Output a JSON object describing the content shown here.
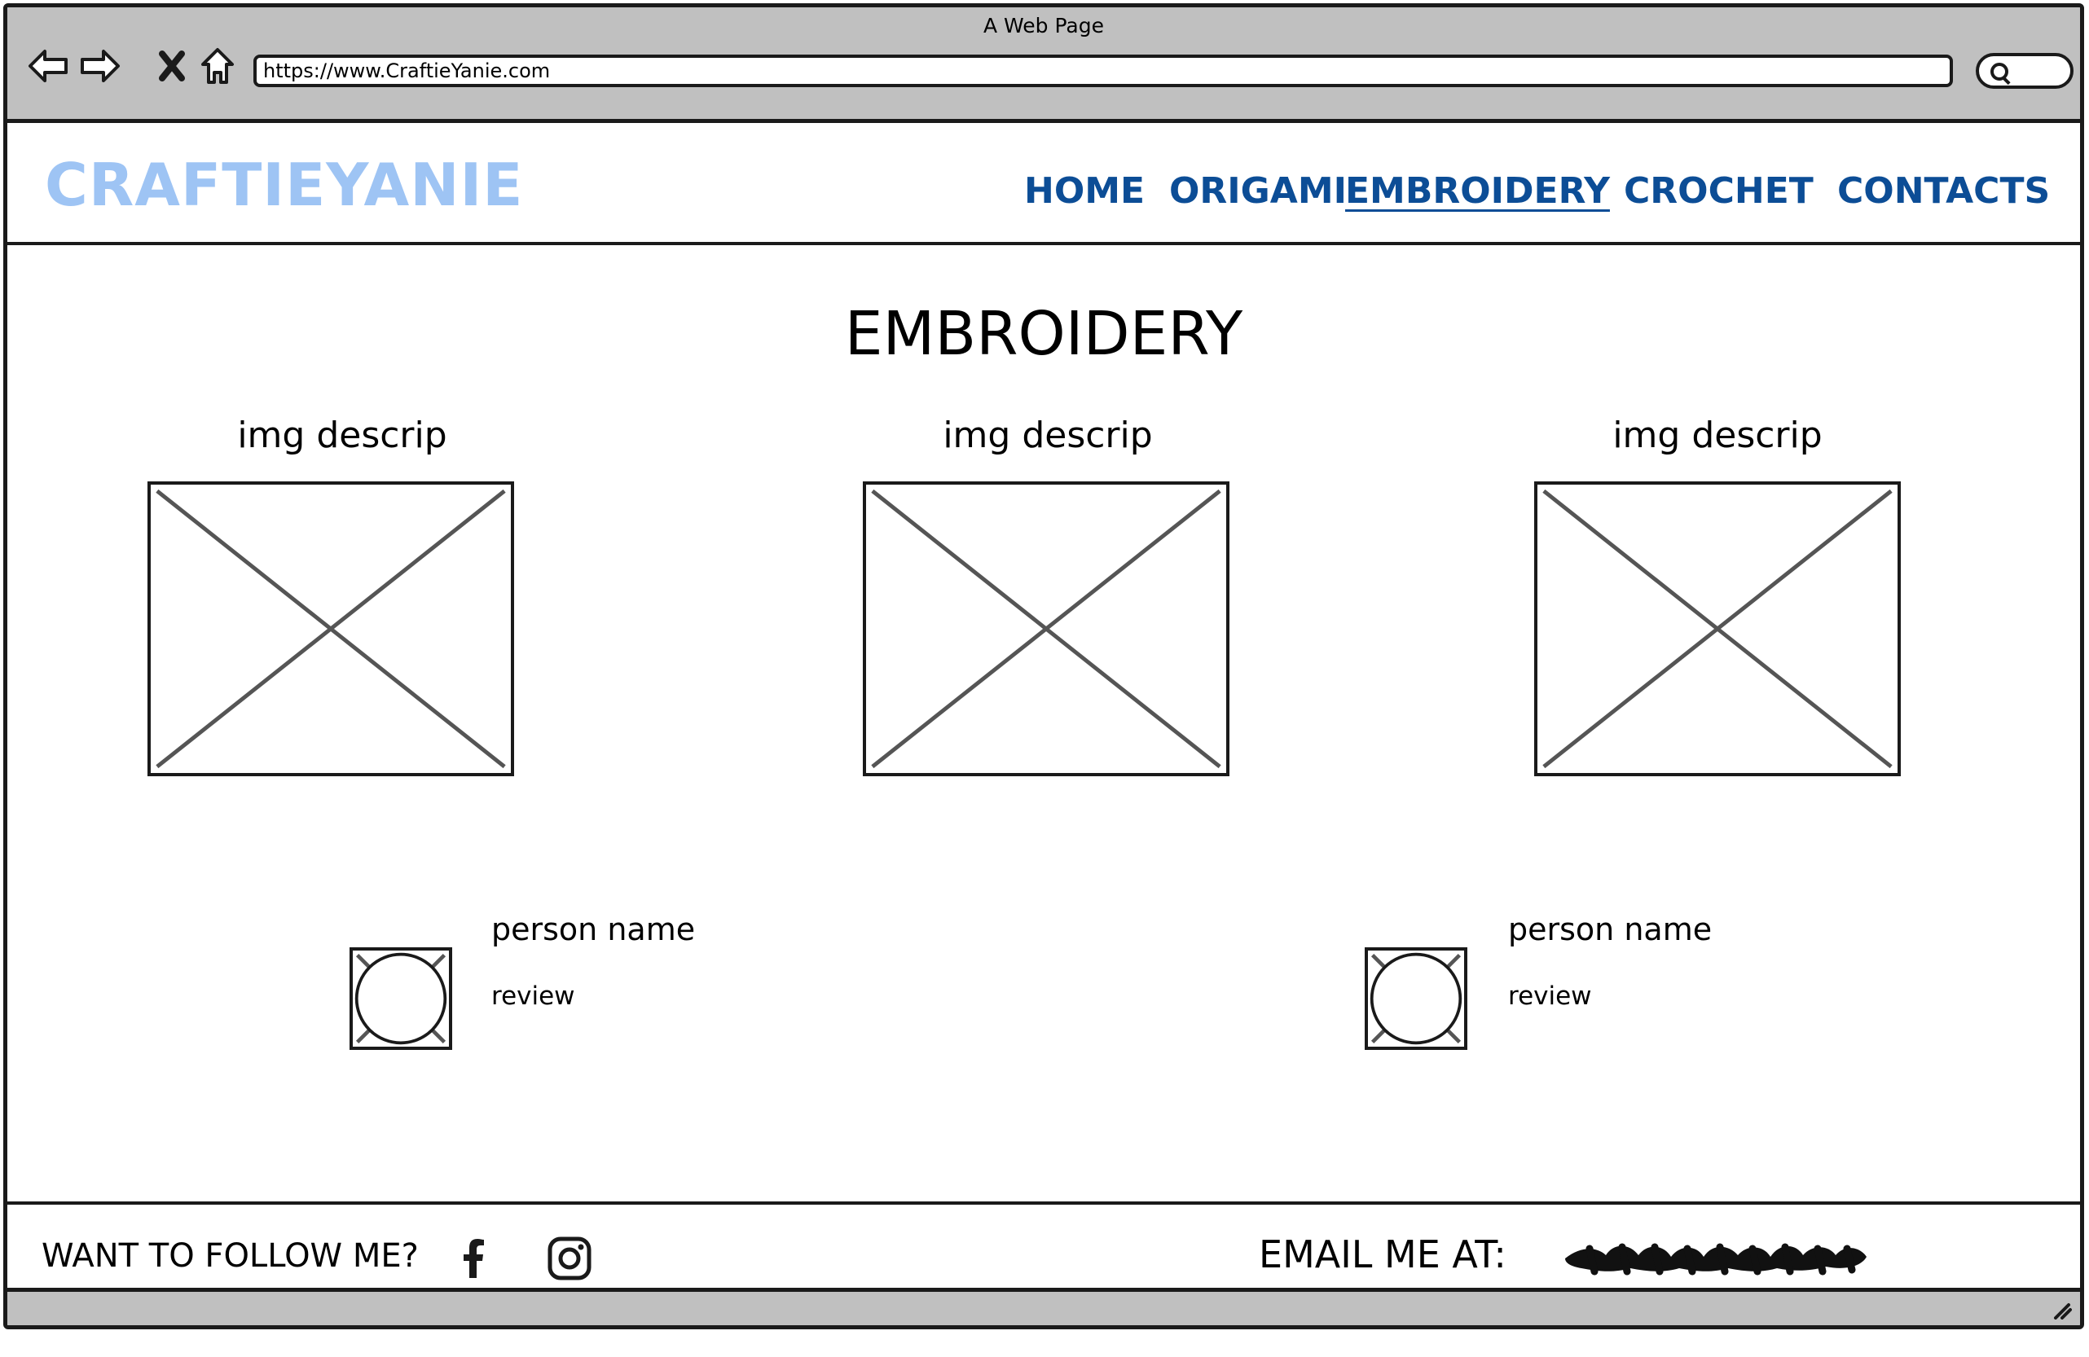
{
  "window": {
    "title": "A Web Page",
    "url": "https://www.CraftieYanie.com",
    "icons": [
      "back-arrow-icon",
      "forward-arrow-icon",
      "close-icon",
      "home-icon",
      "search-icon"
    ]
  },
  "header": {
    "brand": "CRAFTIEYANIE",
    "brand_color": "#9ec4f4",
    "nav_color": "#0c4d96",
    "nav": [
      {
        "label": "HOME",
        "active": false
      },
      {
        "label": "ORIGAMI",
        "active": false
      },
      {
        "label": "EMBROIDERY",
        "active": true
      },
      {
        "label": "CROCHET",
        "active": false
      },
      {
        "label": "CONTACTS",
        "active": false
      }
    ]
  },
  "main": {
    "heading": "EMBROIDERY",
    "gallery": [
      {
        "caption": "img descrip"
      },
      {
        "caption": "img descrip"
      },
      {
        "caption": "img descrip"
      }
    ],
    "reviews": [
      {
        "name": "person name",
        "text": "review"
      },
      {
        "name": "person name",
        "text": "review"
      }
    ]
  },
  "footer": {
    "follow_label": "WANT TO FOLLOW ME?",
    "social": [
      "facebook-icon",
      "instagram-icon"
    ],
    "email_label": "EMAIL ME AT:"
  }
}
